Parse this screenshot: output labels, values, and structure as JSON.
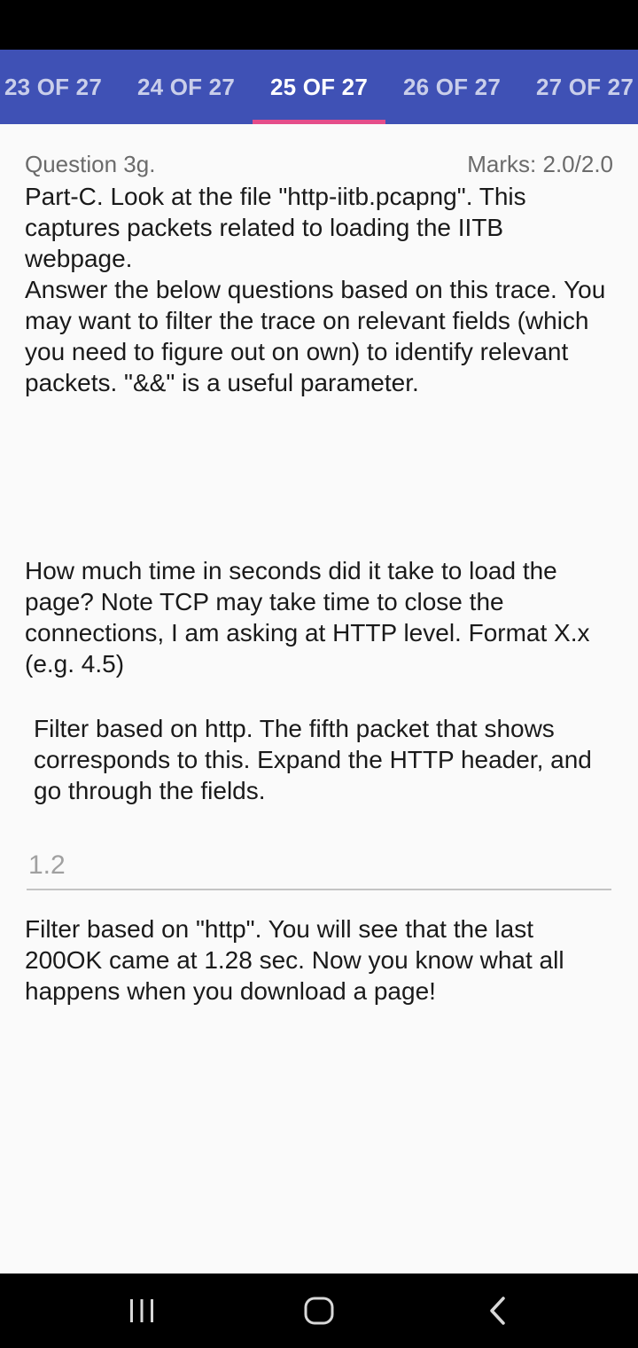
{
  "tabs": [
    {
      "label": "23 OF 27",
      "active": false
    },
    {
      "label": "24 OF 27",
      "active": false
    },
    {
      "label": "25 OF 27",
      "active": true
    },
    {
      "label": "26 OF 27",
      "active": false
    },
    {
      "label": "27 OF 27",
      "active": false
    }
  ],
  "question": {
    "number": "Question 3g.",
    "marks": "Marks: 2.0/2.0",
    "intro": "Part-C. Look at the file \"http-iitb.pcapng\". This captures packets related to loading the IITB webpage.\nAnswer the below questions based on this trace. You may want to filter the trace on relevant fields (which you need to figure out on own) to identify relevant packets. \"&&\" is a useful parameter.",
    "prompt": "How much time in seconds did it take to load the page? Note TCP may take time to close the connections, I am asking at HTTP level. Format X.x (e.g. 4.5)",
    "hint": "Filter based on http. The fifth packet that shows corresponds to this. Expand the HTTP header, and go through the fields.",
    "answer": "1.2",
    "feedback": "Filter based on \"http\". You will see that the last 200OK came at 1.28 sec. Now you know what all happens when you download a page!"
  },
  "colors": {
    "tab_bar": "#3f51b5",
    "tab_indicator": "#e54d8a",
    "background": "#fafafa"
  },
  "nav": {
    "recents": "recents-icon",
    "home": "home-icon",
    "back": "back-icon"
  }
}
